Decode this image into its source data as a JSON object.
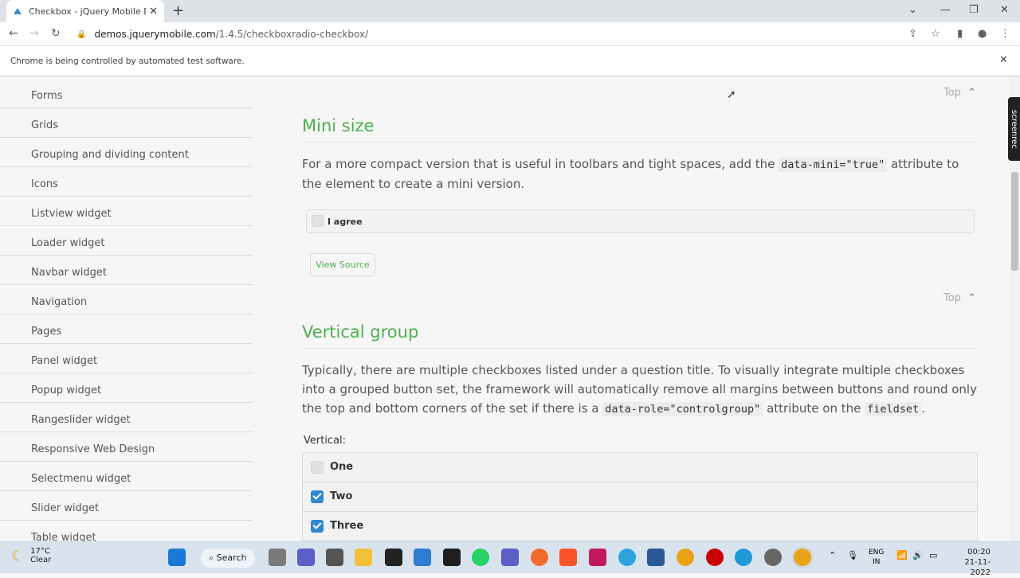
{
  "browser": {
    "tab_title": "Checkbox - jQuery Mobile Demo",
    "url_host": "demos.jquerymobile.com",
    "url_path": "/1.4.5/checkboxradio-checkbox/",
    "infobar_text": "Chrome is being controlled by automated test software."
  },
  "sidebar": {
    "items": [
      {
        "label": "Forms"
      },
      {
        "label": "Grids"
      },
      {
        "label": "Grouping and dividing content"
      },
      {
        "label": "Icons"
      },
      {
        "label": "Listview widget"
      },
      {
        "label": "Loader widget"
      },
      {
        "label": "Navbar widget"
      },
      {
        "label": "Navigation"
      },
      {
        "label": "Pages"
      },
      {
        "label": "Panel widget"
      },
      {
        "label": "Popup widget"
      },
      {
        "label": "Rangeslider widget"
      },
      {
        "label": "Responsive Web Design"
      },
      {
        "label": "Selectmenu widget"
      },
      {
        "label": "Slider widget"
      },
      {
        "label": "Table widget"
      }
    ]
  },
  "content": {
    "top_label": "Top",
    "mini": {
      "heading": "Mini size",
      "para_before": "For a more compact version that is useful in toolbars and tight spaces, add the ",
      "code": "data-mini=\"true\"",
      "para_after": " attribute to the element to create a mini version.",
      "checkbox_label": "I agree",
      "view_source": "View Source"
    },
    "vertical": {
      "heading": "Vertical group",
      "para1": "Typically, there are multiple checkboxes listed under a question title. To visually integrate multiple checkboxes into a grouped button set, the framework will automatically remove all margins between buttons and round only the top and bottom corners of the set if there is a ",
      "code1": "data-role=\"controlgroup\"",
      "para2": " attribute on the ",
      "code2": "fieldset",
      "para3": ".",
      "legend": "Vertical:",
      "options": [
        {
          "label": "One",
          "checked": false
        },
        {
          "label": "Two",
          "checked": true
        },
        {
          "label": "Three",
          "checked": true
        }
      ]
    }
  },
  "overlay": {
    "recorder_label": "screenrec"
  },
  "taskbar": {
    "temp": "17°C",
    "condition": "Clear",
    "search_label": "Search",
    "lang1": "ENG",
    "lang2": "IN",
    "time": "00:20",
    "date": "21-11-2022"
  },
  "colors": {
    "accent_green": "#4db04d",
    "checkbox_blue": "#3388cc"
  }
}
